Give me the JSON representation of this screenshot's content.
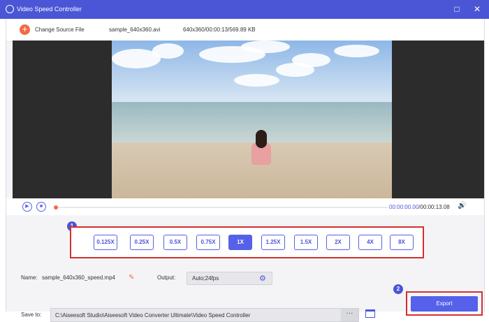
{
  "window": {
    "title": "Video Speed Controller"
  },
  "toolbar": {
    "change_source_label": "Change Source File",
    "filename": "sample_640x360.avi",
    "info": "640x360/00:00:13/569.89 KB"
  },
  "player": {
    "current_time": "00:00:00.00",
    "total_time": "/00:00:13.08"
  },
  "speed": {
    "options": [
      "0.125X",
      "0.25X",
      "0.5X",
      "0.75X",
      "1X",
      "1.25X",
      "1.5X",
      "2X",
      "4X",
      "8X"
    ],
    "selected": "1X"
  },
  "badges": {
    "one": "1",
    "two": "2"
  },
  "output_settings": {
    "name_label": "Name:",
    "name_value": "sample_640x360_speed.mp4",
    "output_label": "Output:",
    "output_value": "Auto;24fps",
    "save_label": "Save to:",
    "save_path": "C:\\Aiseesoft Studio\\Aiseesoft Video Converter Ultimate\\Video Speed Controller",
    "more_label": "···"
  },
  "actions": {
    "export_label": "Export"
  },
  "colors": {
    "accent": "#4b56d6",
    "orange": "#f26c45",
    "highlight_red": "#d42f2f"
  }
}
